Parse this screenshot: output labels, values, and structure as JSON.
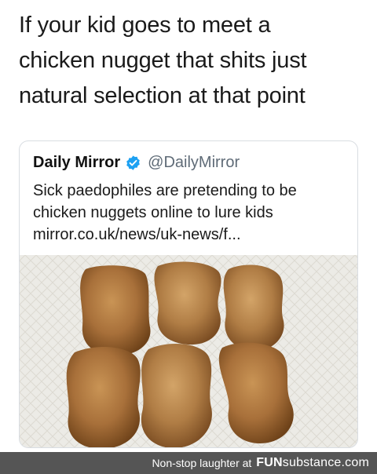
{
  "post": {
    "text": "If your kid goes to meet a\nchicken nugget that shits just\nnatural selection at that point"
  },
  "quoted_tweet": {
    "name": "Daily Mirror",
    "verified_icon": "verified-badge-icon",
    "handle": "@DailyMirror",
    "text": "Sick paedophiles are pretending to be\nchicken nuggets online to lure kids\nmirror.co.uk/news/uk-news/f..."
  },
  "footer": {
    "caption": "Non-stop laughter at",
    "logo_fun": "FUN",
    "logo_rest": "substance.com",
    "color": "#555555"
  },
  "colors": {
    "verified_blue": "#1da1f2",
    "handle_gray": "#5f6b77"
  }
}
